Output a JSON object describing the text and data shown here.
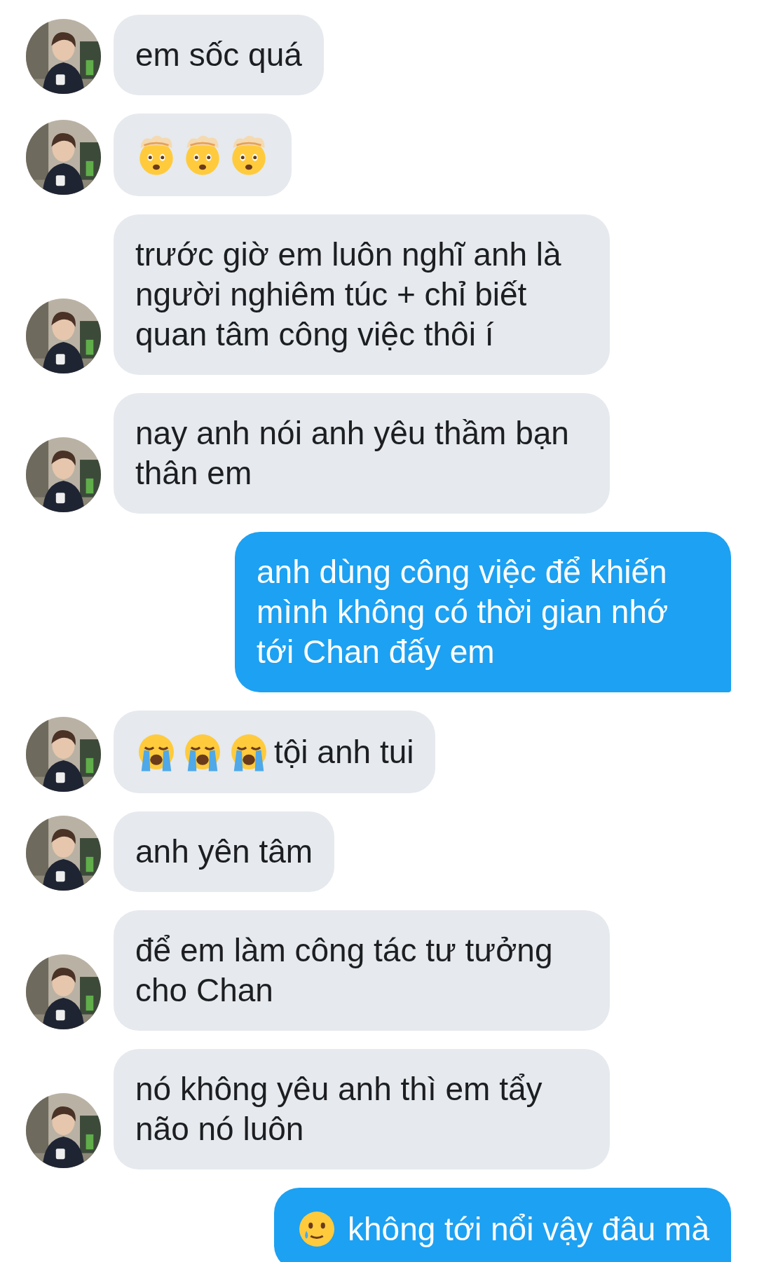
{
  "messages": [
    {
      "kind": "received",
      "avatar": {
        "kind": "picture"
      },
      "parts": [
        {
          "kind": "text",
          "text": "em sốc quá"
        }
      ]
    },
    {
      "kind": "received",
      "avatar": {
        "kind": "picture"
      },
      "parts": [
        {
          "kind": "exploding"
        },
        {
          "kind": "exploding"
        },
        {
          "kind": "exploding"
        }
      ]
    },
    {
      "kind": "received",
      "avatar": {
        "kind": "picture"
      },
      "parts": [
        {
          "kind": "text",
          "text": "trước giờ em luôn nghĩ anh là người nghiêm túc + chỉ biết quan tâm công việc thôi í"
        }
      ]
    },
    {
      "kind": "received",
      "avatar": {
        "kind": "picture"
      },
      "parts": [
        {
          "kind": "text",
          "text": "nay anh nói anh yêu thầm bạn thân em"
        }
      ]
    },
    {
      "kind": "sent",
      "parts": [
        {
          "kind": "text",
          "text": "anh dùng công việc để khiến mình không có thời gian nhớ tới Chan đấy em"
        }
      ]
    },
    {
      "kind": "received",
      "avatar": {
        "kind": "picture"
      },
      "parts": [
        {
          "kind": "crying"
        },
        {
          "kind": "crying"
        },
        {
          "kind": "crying"
        },
        {
          "kind": "text",
          "text": "tội anh tui"
        }
      ]
    },
    {
      "kind": "received",
      "avatar": {
        "kind": "picture"
      },
      "parts": [
        {
          "kind": "text",
          "text": "anh yên tâm"
        }
      ]
    },
    {
      "kind": "received",
      "avatar": {
        "kind": "picture"
      },
      "parts": [
        {
          "kind": "text",
          "text": "để em làm công tác tư tưởng cho Chan"
        }
      ]
    },
    {
      "kind": "received",
      "avatar": {
        "kind": "picture"
      },
      "parts": [
        {
          "kind": "text",
          "text": "nó không yêu anh thì em tẩy não nó luôn"
        }
      ]
    },
    {
      "kind": "sent",
      "parts": [
        {
          "kind": "tearsmile"
        },
        {
          "kind": "text",
          "text": "không tới nổi vậy đâu mà"
        }
      ]
    }
  ]
}
